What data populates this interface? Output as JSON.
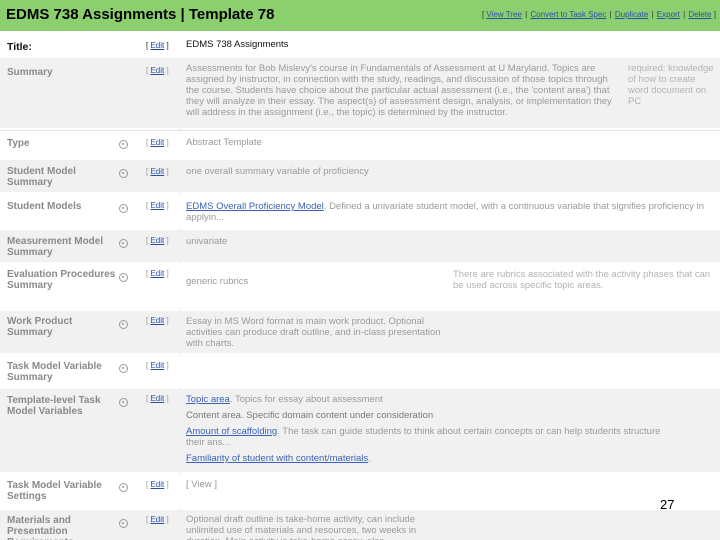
{
  "header": {
    "title": "EDMS 738 Assignments | Template 78",
    "actions": [
      "View Tree",
      "Convert to Task Spec",
      "Duplicate",
      "Export",
      "Delete"
    ]
  },
  "edit_label": "Edit",
  "rows": [
    {
      "label": "Title:",
      "value": "EDMS 738 Assignments"
    },
    {
      "label": "Summary",
      "value": "Assessments for Bob Mislevy's course in Fundamentals of Assessment at U Maryland. Topics are assigned by instructor, in connection with the study, readings, and discussion of those topics through the course. Students have choice about the particular actual assessment (i.e., the 'content area') that they will analyze in their essay. The aspect(s) of assessment design, analysis, or implementation they will address in the assignment (i.e., the topic) is determined by the instructor.",
      "aside": "required: knowledge of how to create word document on PC"
    },
    {
      "label": "Type",
      "value": "Abstract Template"
    },
    {
      "label": "Student Model Summary",
      "value": "one overall summary variable of proficiency"
    },
    {
      "label": "Student Models",
      "link": "EDMS Overall Proficiency Model",
      "value": ". Defined a univariate student model, with a continuous variable that signifies proficiency in applyin..."
    },
    {
      "label": "Measurement Model Summary",
      "value": "univariate"
    },
    {
      "label": "Evaluation Procedures Summary",
      "value": "generic rubrics",
      "aside": "There are rubrics associated with the activity phases that can be used across specific topic areas."
    },
    {
      "label": "Work Product Summary",
      "value": "Essay in MS Word format is main work product. Optional activities can produce draft outline, and in-class presentation with charts."
    },
    {
      "label": "Task Model Variable Summary",
      "value": ""
    },
    {
      "label": "Template-level Task Model Variables",
      "items": [
        {
          "link": "Topic area",
          "text": ". Topics for essay about assessment"
        },
        {
          "link": "",
          "text": "Content area. Specific domain content under consideration"
        },
        {
          "link": "Amount of scaffolding",
          "text": ". The task can guide students to think about certain concepts or can help students structure their ans..."
        },
        {
          "link": "Familiarity of student with content/materials",
          "text": "."
        }
      ]
    },
    {
      "label": "Task Model Variable Settings",
      "value": "[ View ]"
    },
    {
      "label": "Materials and Presentation Requirements",
      "value": "Optional draft outline is take-home activity, can include unlimited use of materials and resources, two weeks in duration. Main activity is take-home essay, also ..."
    }
  ],
  "page_number": "27"
}
